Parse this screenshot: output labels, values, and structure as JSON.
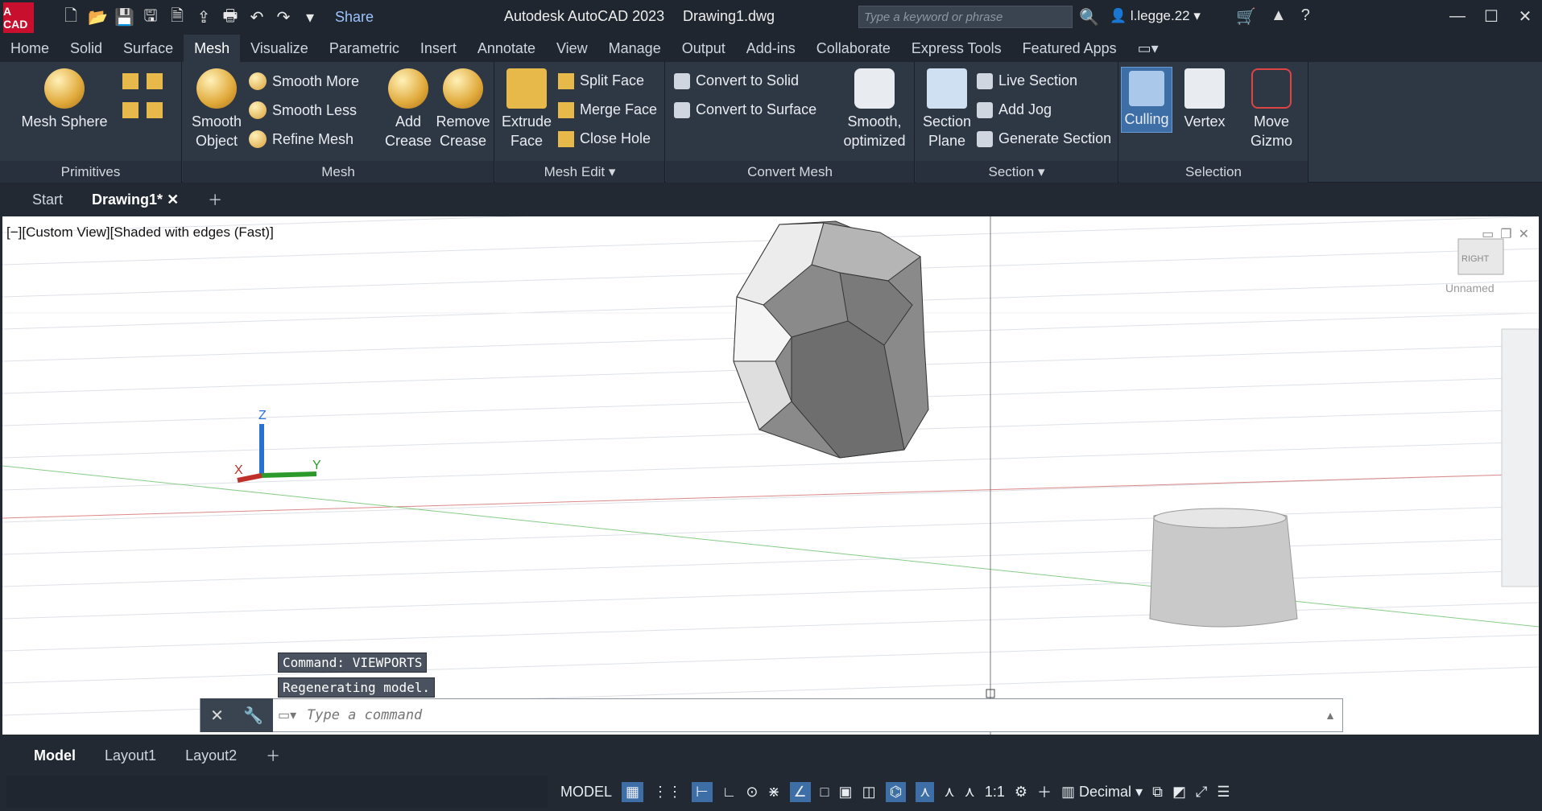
{
  "app": {
    "logo": "A CAD",
    "title": "Autodesk AutoCAD 2023",
    "document": "Drawing1.dwg",
    "share": "Share",
    "search_placeholder": "Type a keyword or phrase",
    "user": "l.legge.22"
  },
  "ribbon_tabs": [
    "Home",
    "Solid",
    "Surface",
    "Mesh",
    "Visualize",
    "Parametric",
    "Insert",
    "Annotate",
    "View",
    "Manage",
    "Output",
    "Add-ins",
    "Collaborate",
    "Express Tools",
    "Featured Apps"
  ],
  "ribbon": {
    "primitives": {
      "title": "Primitives",
      "mesh_sphere": "Mesh Sphere"
    },
    "mesh": {
      "title": "Mesh",
      "smooth_object": "Smooth Object",
      "smooth_more": "Smooth More",
      "smooth_less": "Smooth Less",
      "refine_mesh": "Refine Mesh",
      "add_crease": "Add Crease",
      "remove_crease": "Remove Crease"
    },
    "mesh_edit": {
      "title": "Mesh Edit",
      "extrude_face": "Extrude Face",
      "split_face": "Split Face",
      "merge_face": "Merge Face",
      "close_hole": "Close Hole"
    },
    "convert_mesh": {
      "title": "Convert Mesh",
      "to_solid": "Convert to Solid",
      "to_surface": "Convert to Surface",
      "smooth_optimized": "Smooth, optimized"
    },
    "section": {
      "title": "Section",
      "section_plane": "Section Plane",
      "live_section": "Live Section",
      "add_jog": "Add Jog",
      "generate_section": "Generate Section"
    },
    "selection": {
      "title": "Selection",
      "culling": "Culling",
      "vertex": "Vertex",
      "move_gizmo": "Move Gizmo"
    }
  },
  "doc_tabs": {
    "start": "Start",
    "drawing": "Drawing1*"
  },
  "viewport": {
    "label": "[−][Custom View][Shaded with edges (Fast)]",
    "viewcube": "RIGHT",
    "named_view": "Unnamed",
    "axis_x": "X",
    "axis_y": "Y",
    "axis_z": "Z"
  },
  "command": {
    "history": [
      "Command: VIEWPORTS",
      "Regenerating model."
    ],
    "placeholder": "Type a command"
  },
  "layout_tabs": [
    "Model",
    "Layout1",
    "Layout2"
  ],
  "status": {
    "model": "MODEL",
    "scale": "1:1",
    "units": "Decimal"
  }
}
